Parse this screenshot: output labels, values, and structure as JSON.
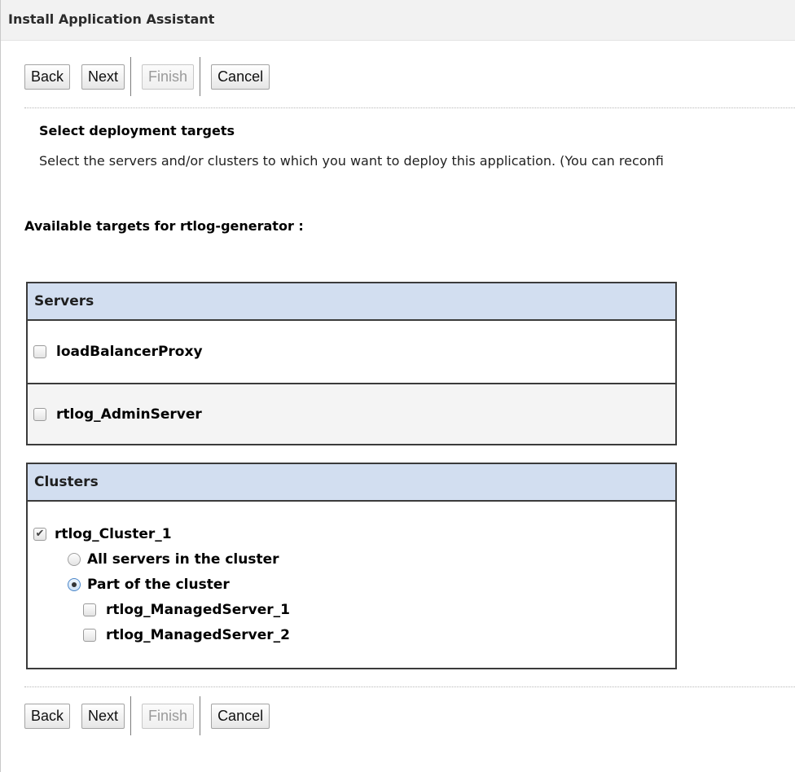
{
  "window": {
    "title": "Install Application Assistant"
  },
  "toolbar": {
    "back_label": "Back",
    "next_label": "Next",
    "finish_label": "Finish",
    "cancel_label": "Cancel"
  },
  "section": {
    "title": "Select deployment targets",
    "description": "Select the servers and/or clusters to which you want to deploy this application. (You can reconfi"
  },
  "targets": {
    "heading": "Available targets for rtlog-generator :"
  },
  "servers": {
    "header": "Servers",
    "items": [
      {
        "label": "loadBalancerProxy",
        "checked": false
      },
      {
        "label": "rtlog_AdminServer",
        "checked": false
      }
    ]
  },
  "clusters": {
    "header": "Clusters",
    "cluster": {
      "label": "rtlog_Cluster_1",
      "checked": true,
      "checkmark": "✔"
    },
    "options": [
      {
        "label": "All servers in the cluster",
        "selected": false
      },
      {
        "label": "Part of the cluster",
        "selected": true
      }
    ],
    "members": [
      {
        "label": "rtlog_ManagedServer_1",
        "checked": false
      },
      {
        "label": "rtlog_ManagedServer_2",
        "checked": false
      }
    ]
  },
  "colors": {
    "panel_header_bg": "#d2def0",
    "panel_border": "#3b3b3b",
    "title_bar_bg": "#f2f2f2"
  }
}
